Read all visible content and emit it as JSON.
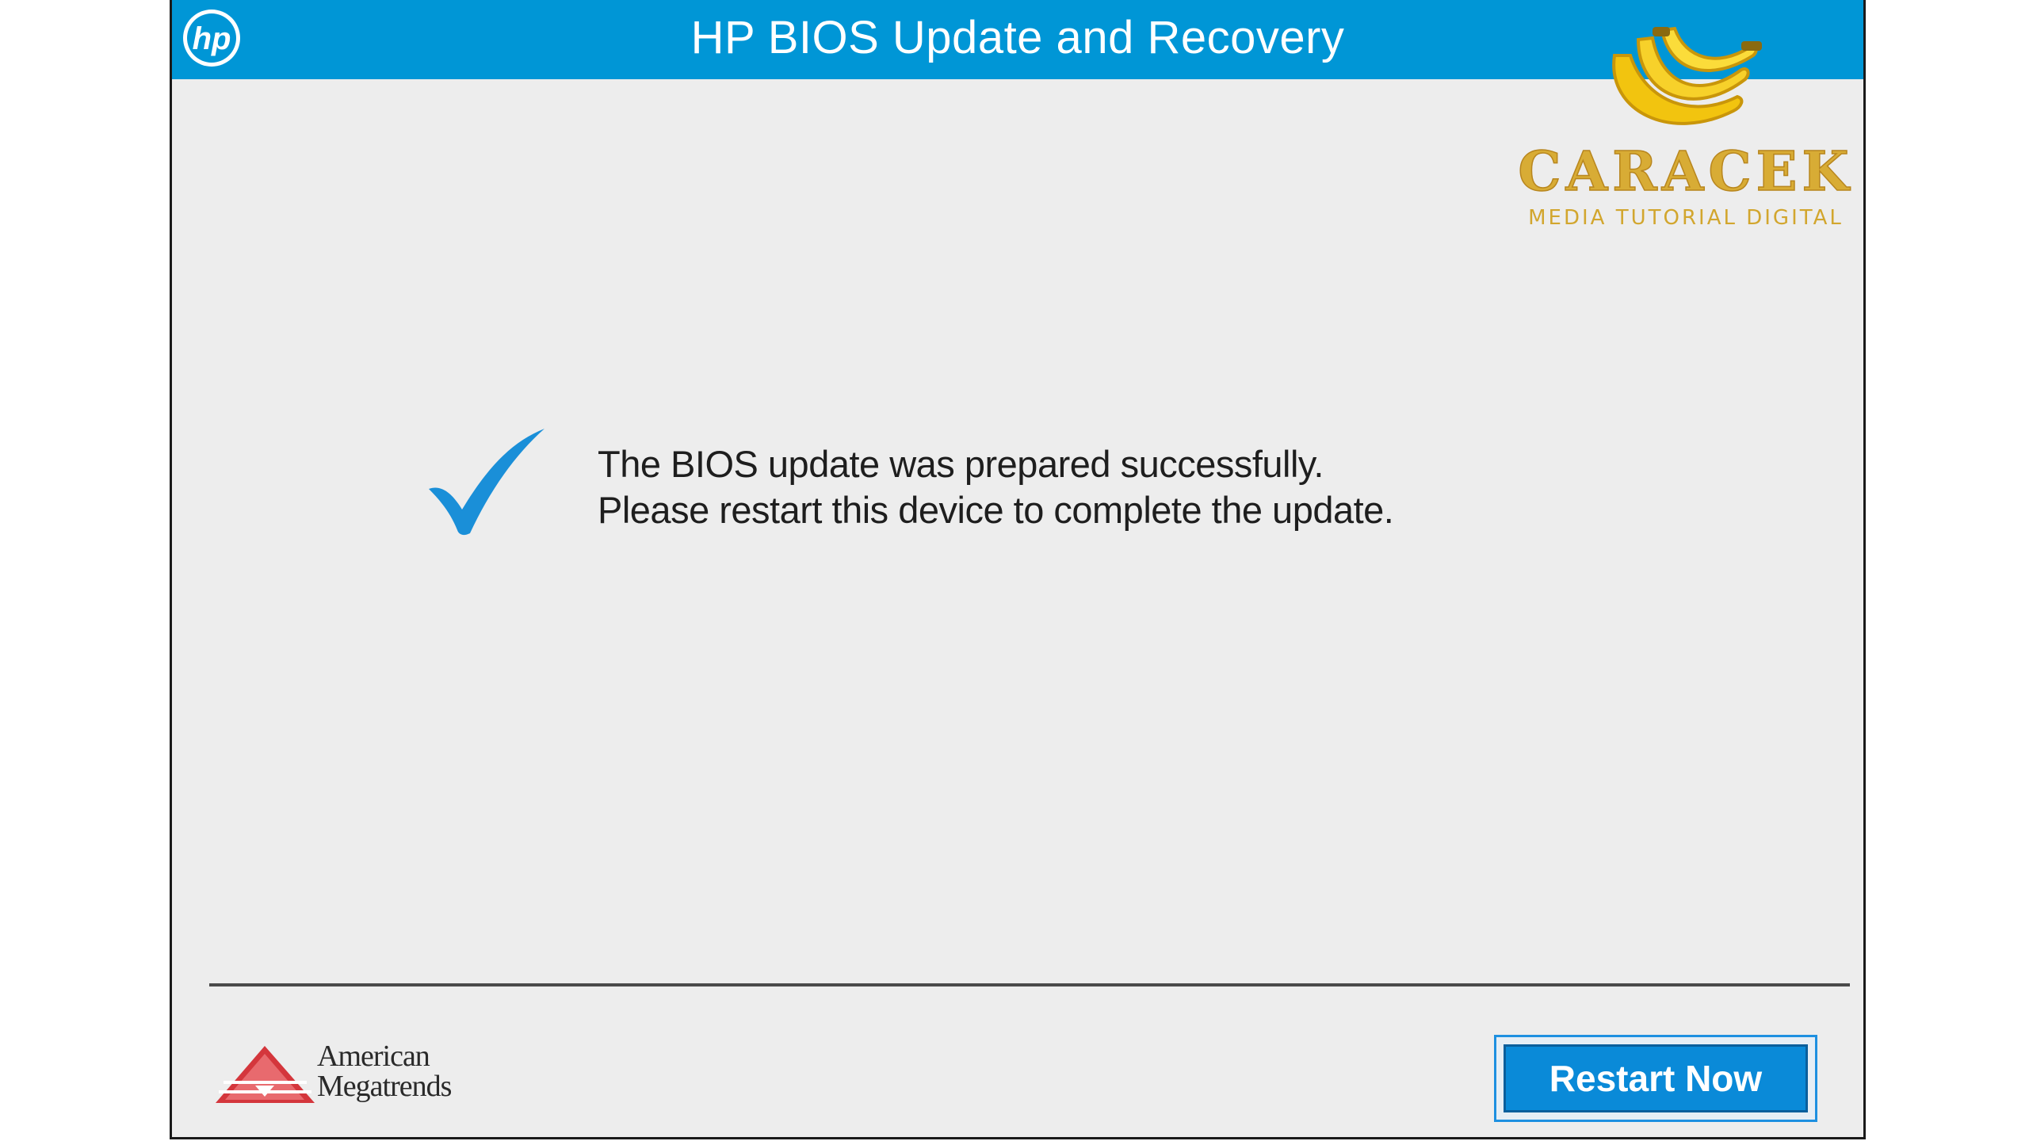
{
  "window": {
    "title": "HP BIOS Update and Recovery",
    "logo_text": "hp"
  },
  "watermark": {
    "brand": "CARACEK",
    "tagline": "MEDIA TUTORIAL DIGITAL",
    "icon": "banana-icon"
  },
  "status": {
    "icon": "checkmark-icon",
    "line1": "The BIOS update was prepared successfully.",
    "line2": "Please restart this device to complete the update."
  },
  "footer": {
    "vendor_line1": "American",
    "vendor_line2": "Megatrends",
    "restart_label": "Restart Now"
  },
  "colors": {
    "titlebar": "#0096d6",
    "background": "#ededed",
    "accent": "#0a8ad8",
    "check": "#1a8fd8",
    "watermark_gold": "#d2a62e",
    "ami_red": "#d4363c"
  }
}
